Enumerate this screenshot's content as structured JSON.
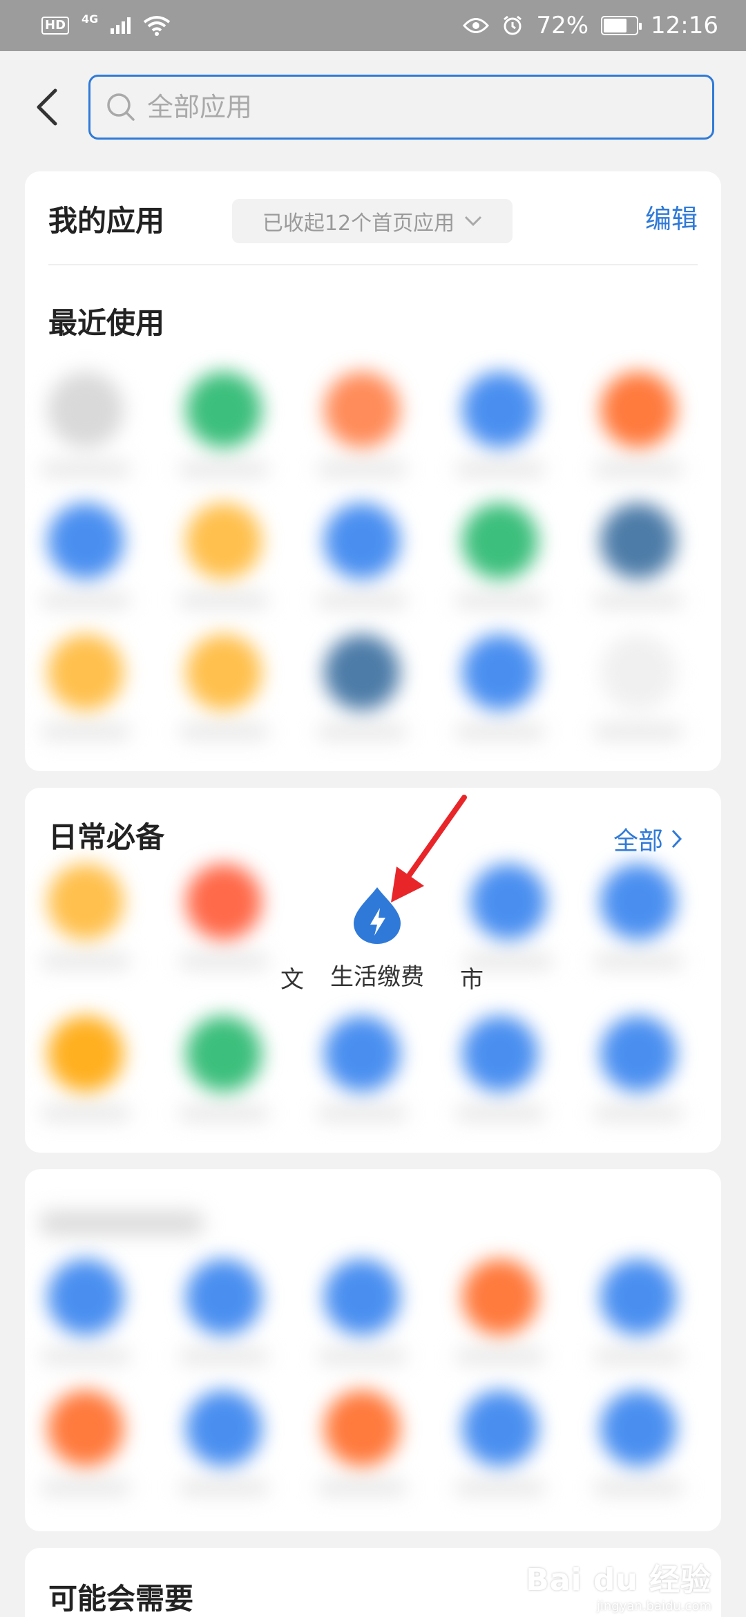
{
  "status_bar": {
    "hd": "HD",
    "network": "4G",
    "battery_text": "72%",
    "battery_level": 0.72,
    "time": "12:16"
  },
  "search": {
    "placeholder": "全部应用"
  },
  "my_apps": {
    "title": "我的应用",
    "collapsed_hint": "已收起12个首页应用",
    "edit": "编辑"
  },
  "recent": {
    "title": "最近使用",
    "rows": [
      [
        "#d9d9d9",
        "#3cbf7c",
        "#ff8c5a",
        "#4a8ff0",
        "#ff7a3d"
      ],
      [
        "#4a8ff0",
        "#ffc04d",
        "#4a8ff0",
        "#3cbf7c",
        "#4d7ca8"
      ],
      [
        "#ffc04d",
        "#ffc04d",
        "#4d7ca8",
        "#4a8ff0",
        "#f0f0f0"
      ]
    ]
  },
  "daily": {
    "title": "日常必备",
    "all": "全部",
    "featured_app": {
      "label": "生活缴费",
      "icon": "lightning-drop-icon",
      "color": "#2f7ad8"
    },
    "left_peek": "文",
    "right_peek": "市",
    "row1_blurred": [
      "#ffc04d",
      "#ff6a4a",
      "#4a8ff0",
      "#4a8ff0"
    ],
    "row2_blurred": [
      "#ffb020",
      "#3cbf7c",
      "#4a8ff0",
      "#4a8ff0",
      "#4a8ff0"
    ]
  },
  "blurred_section": {
    "rows": [
      [
        "#4a8ff0",
        "#4a8ff0",
        "#4a8ff0",
        "#ff7a3d",
        "#4a8ff0"
      ],
      [
        "#ff7a3d",
        "#4a8ff0",
        "#ff7a3d",
        "#4a8ff0",
        "#4a8ff0"
      ]
    ]
  },
  "maybe_need": {
    "title": "可能会需要"
  },
  "watermark": {
    "logo": "Bai du 经验",
    "url": "jingyan.baidu.com"
  },
  "colors": {
    "accent": "#2f7ad8",
    "arrow": "#e8262a"
  }
}
